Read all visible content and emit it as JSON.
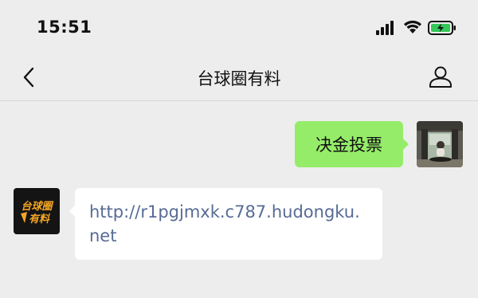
{
  "status_bar": {
    "time": "15:51",
    "icons": [
      "signal-icon",
      "wifi-icon",
      "battery-charging-icon"
    ],
    "battery_color": "#34c759"
  },
  "nav": {
    "title": "台球圈有料",
    "back_icon": "chevron-left-icon",
    "profile_icon": "person-icon"
  },
  "messages": [
    {
      "direction": "sent",
      "text": "决金投票",
      "bubble_color": "#95ec69"
    },
    {
      "direction": "received",
      "text": "http://r1pgjmxk.c787.hudongku.net",
      "link_color": "#576b95"
    }
  ],
  "sender_logo": {
    "text_line1": "台球圈",
    "text_line2": "有料",
    "color": "#f5a623"
  },
  "colors": {
    "background": "#ededed",
    "text": "#111111"
  }
}
